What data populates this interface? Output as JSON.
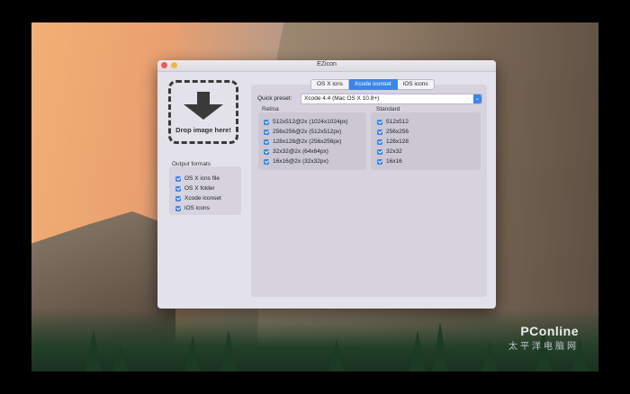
{
  "window": {
    "title": "EZicon"
  },
  "dropzone": {
    "label": "Drop image here!",
    "icon": "down-arrow-icon"
  },
  "output_formats": {
    "title": "Output formats",
    "items": [
      {
        "label": "OS X icns file",
        "checked": true
      },
      {
        "label": "OS X folder",
        "checked": true
      },
      {
        "label": "Xcode iconset",
        "checked": true
      },
      {
        "label": "iOS icons",
        "checked": true
      }
    ]
  },
  "tabs": [
    {
      "label": "OS X icns",
      "active": false
    },
    {
      "label": "Xcode iconset",
      "active": true
    },
    {
      "label": "iOS icons",
      "active": false
    }
  ],
  "quick_preset": {
    "label": "Quick preset:",
    "value": "Xcode 4.4 (Mac OS X 10.8+)"
  },
  "retina": {
    "title": "Retina",
    "items": [
      {
        "label": "512x512@2x (1024x1024px)",
        "checked": true
      },
      {
        "label": "256x256@2x (512x512px)",
        "checked": true
      },
      {
        "label": "128x128@2x (256x256px)",
        "checked": true
      },
      {
        "label": "32x32@2x (64x64px)",
        "checked": true
      },
      {
        "label": "16x16@2x (32x32px)",
        "checked": true
      }
    ]
  },
  "standard": {
    "title": "Standard",
    "items": [
      {
        "label": "512x512",
        "checked": true
      },
      {
        "label": "256x256",
        "checked": true
      },
      {
        "label": "128x128",
        "checked": true
      },
      {
        "label": "32x32",
        "checked": true
      },
      {
        "label": "16x16",
        "checked": true
      }
    ]
  },
  "watermark": {
    "brand": "PConline",
    "sub": "太平洋电脑网"
  },
  "colors": {
    "accent": "#3b86e8",
    "window_bg": "#e3e1ea",
    "panel_bg": "#d6d3df"
  }
}
